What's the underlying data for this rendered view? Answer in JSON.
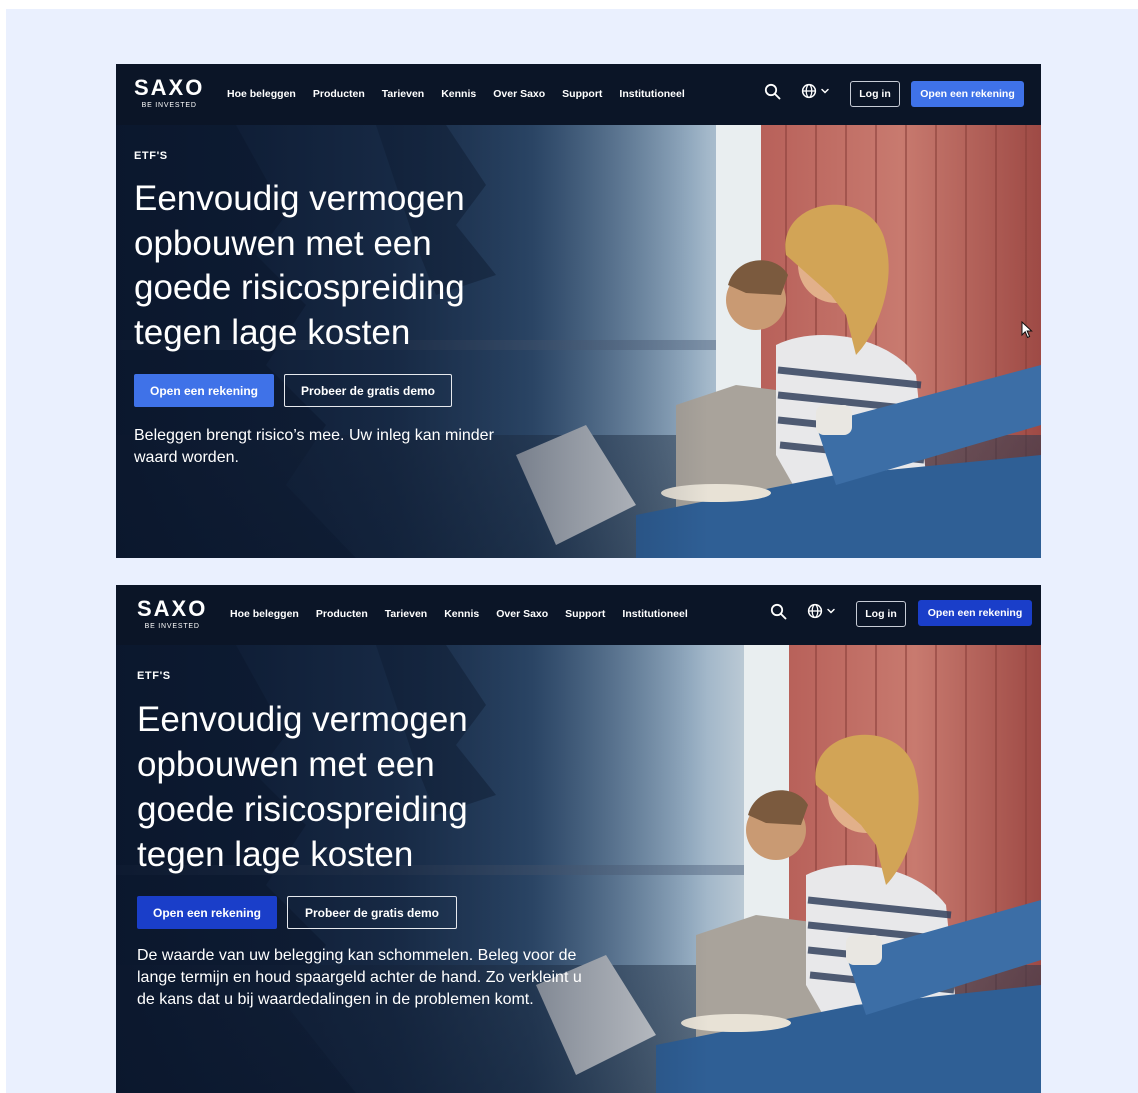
{
  "colors": {
    "canvas": "#eaf0fe",
    "nav_bg": "#0b1527",
    "accent_blue_v1": "#3f72e8",
    "accent_blue_v2": "#1a3ec9",
    "text": "#ffffff"
  },
  "nav": {
    "logo": "SAXO",
    "tagline": "BE INVESTED",
    "items": [
      "Hoe beleggen",
      "Producten",
      "Tarieven",
      "Kennis",
      "Over Saxo",
      "Support",
      "Institutioneel"
    ],
    "search_icon": "search-icon",
    "language_icon": "globe-icon",
    "login_label": "Log in",
    "open_account_label": "Open een rekening"
  },
  "hero": {
    "eyebrow": "ETF'S",
    "headline": "Eenvoudig vermogen opbouwen met een goede risicospreiding tegen lage kosten",
    "primary_cta": "Open een rekening",
    "secondary_cta": "Probeer de gratis demo"
  },
  "variants": [
    {
      "disclaimer": "Beleggen brengt risico’s mee. Uw inleg kan minder waard worden."
    },
    {
      "disclaimer": "De waarde van uw belegging kan schommelen. Beleg voor de lange termijn en houd spaargeld achter de hand. Zo verkleint u de kans dat u bij waardedalingen in de problemen komt."
    }
  ]
}
